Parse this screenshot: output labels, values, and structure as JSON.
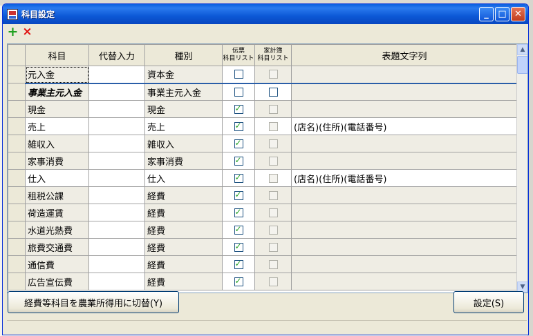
{
  "window": {
    "title": "科目設定"
  },
  "toolbar": {
    "add_label": "+",
    "delete_label": "×"
  },
  "columns": [
    "科目",
    "代替入力",
    "種別",
    "伝票\n科目リスト",
    "家計簿\n科目リスト",
    "表題文字列"
  ],
  "rows": [
    {
      "subject": "元入金",
      "alt": "",
      "type": "資本金",
      "slip": false,
      "household": false,
      "title": ""
    },
    {
      "subject": "事業主元入金",
      "alt": "",
      "type": "事業主元入金",
      "slip": false,
      "household": false,
      "title": ""
    },
    {
      "subject": "現金",
      "alt": "",
      "type": "現金",
      "slip": true,
      "household": false,
      "title": ""
    },
    {
      "subject": "売上",
      "alt": "",
      "type": "売上",
      "slip": true,
      "household": false,
      "title": "(店名)(住所)(電話番号)"
    },
    {
      "subject": "雑収入",
      "alt": "",
      "type": "雑収入",
      "slip": true,
      "household": false,
      "title": ""
    },
    {
      "subject": "家事消費",
      "alt": "",
      "type": "家事消費",
      "slip": true,
      "household": false,
      "title": ""
    },
    {
      "subject": "仕入",
      "alt": "",
      "type": "仕入",
      "slip": true,
      "household": false,
      "title": "(店名)(住所)(電話番号)"
    },
    {
      "subject": "租税公課",
      "alt": "",
      "type": "経費",
      "slip": true,
      "household": false,
      "title": ""
    },
    {
      "subject": "荷造運賃",
      "alt": "",
      "type": "経費",
      "slip": true,
      "household": false,
      "title": ""
    },
    {
      "subject": "水道光熱費",
      "alt": "",
      "type": "経費",
      "slip": true,
      "household": false,
      "title": ""
    },
    {
      "subject": "旅費交通費",
      "alt": "",
      "type": "経費",
      "slip": true,
      "household": false,
      "title": ""
    },
    {
      "subject": "通信費",
      "alt": "",
      "type": "経費",
      "slip": true,
      "household": false,
      "title": ""
    },
    {
      "subject": "広告宣伝費",
      "alt": "",
      "type": "経費",
      "slip": true,
      "household": false,
      "title": ""
    }
  ],
  "buttons": {
    "switch_label": "経費等科目を農業所得用に切替(Y)",
    "set_label": "設定(S)"
  },
  "colors": {
    "title_bar": "#0a5fe0",
    "accent": "#2a5ea8"
  }
}
